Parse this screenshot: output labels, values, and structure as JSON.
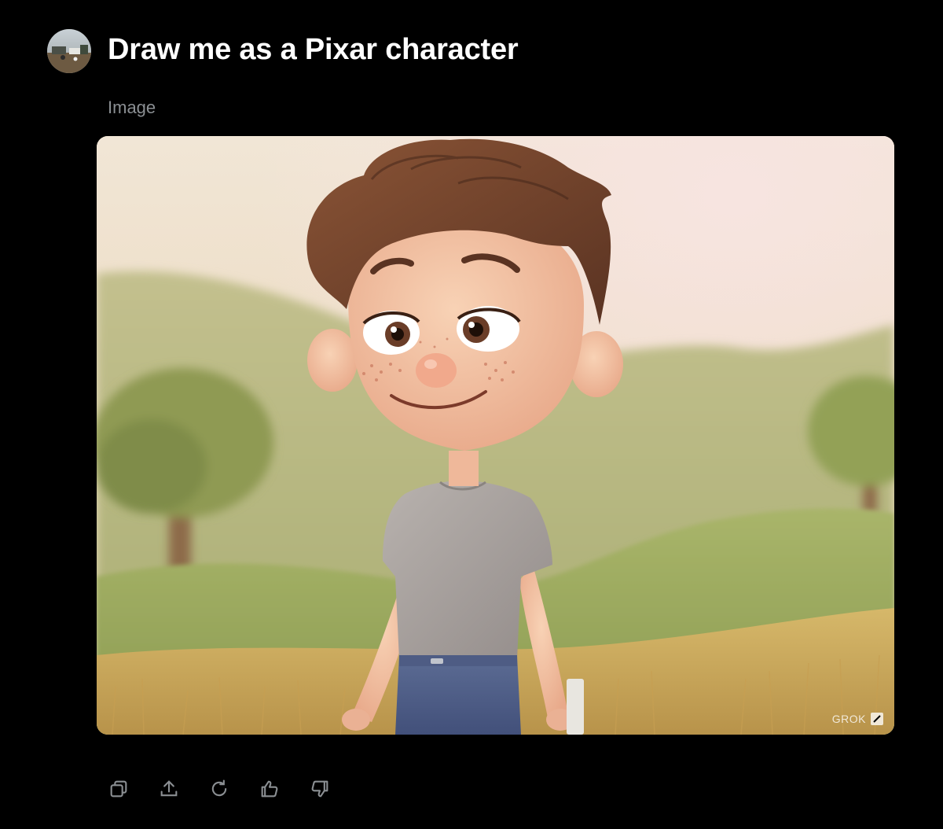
{
  "prompt": {
    "title": "Draw me as a Pixar character",
    "avatar_icon": "user-avatar"
  },
  "response": {
    "section_label": "Image",
    "image_alt": "Pixar-style cartoon boy with brown hair and freckles standing in a sunny grassy field",
    "watermark": "GROK"
  },
  "actions": [
    {
      "name": "copy",
      "icon": "copy-icon"
    },
    {
      "name": "share",
      "icon": "share-icon"
    },
    {
      "name": "regenerate",
      "icon": "refresh-icon"
    },
    {
      "name": "like",
      "icon": "thumbs-up-icon"
    },
    {
      "name": "dislike",
      "icon": "thumbs-down-icon"
    }
  ],
  "colors": {
    "background": "#000000",
    "title": "#ffffff",
    "label": "#8b8f93",
    "icon": "#8b8f93"
  }
}
